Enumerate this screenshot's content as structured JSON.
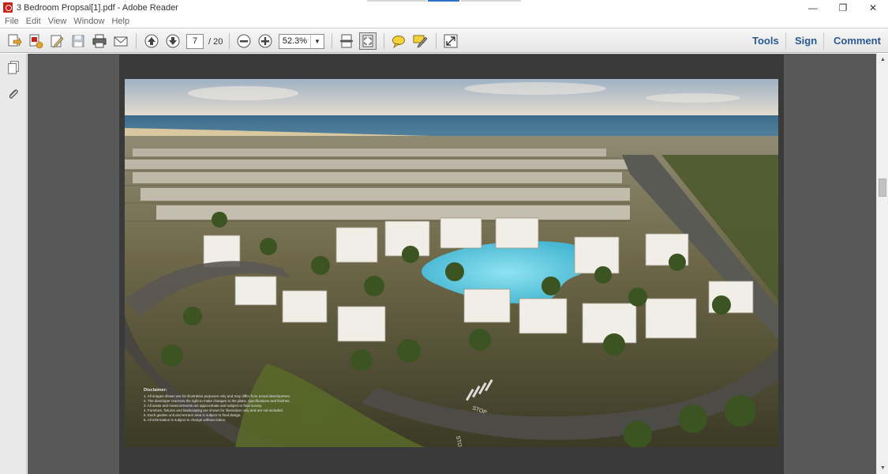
{
  "window": {
    "title": "3 Bedroom Propsal[1].pdf - Adobe Reader",
    "controls": {
      "minimize": "—",
      "restore": "❐",
      "close": "✕"
    }
  },
  "menu": [
    "File",
    "Edit",
    "View",
    "Window",
    "Help"
  ],
  "toolbar": {
    "page_current": "7",
    "page_total": "/ 20",
    "zoom": "52.3%",
    "zoom_arrow": "▼",
    "tools_label": "Tools",
    "sign_label": "Sign",
    "comment_label": "Comment"
  },
  "icons": {
    "create": "create-pdf-icon",
    "export": "export-pdf-icon",
    "edit": "edit-icon",
    "save": "save-icon",
    "print": "print-icon",
    "email": "email-icon",
    "prev_page": "arrow-up-icon",
    "next_page": "arrow-down-icon",
    "zoom_out": "minus-icon",
    "zoom_in": "plus-icon",
    "scrolling": "scroll-mode-icon",
    "fit": "fit-page-icon",
    "comment": "comment-bubble-icon",
    "highlight": "highlight-icon",
    "full_screen": "full-screen-icon",
    "pages": "pages-panel-icon",
    "attachments": "attachment-icon"
  },
  "document": {
    "disclaimer_title": "Disclaimer:",
    "disclaimer_lines": [
      "1. All images shown are for illustrative purposes only and may differ from actual development.",
      "2. The developer reserves the right to make changes to the plans, specifications and finishes.",
      "3. All areas and measurements are approximate and subject to final survey.",
      "4. Furniture, fixtures and landscaping are shown for illustration only and are not included.",
      "5. Each garden unit and terrace area is subject to final design.",
      "6. All information is subject to change without notice."
    ],
    "road_marking_1": "STOP",
    "road_marking_2": "STOP"
  },
  "colors": {
    "accent_blue": "#2a5a92",
    "page_bg": "#585858",
    "acrobat_red": "#c8231b"
  }
}
